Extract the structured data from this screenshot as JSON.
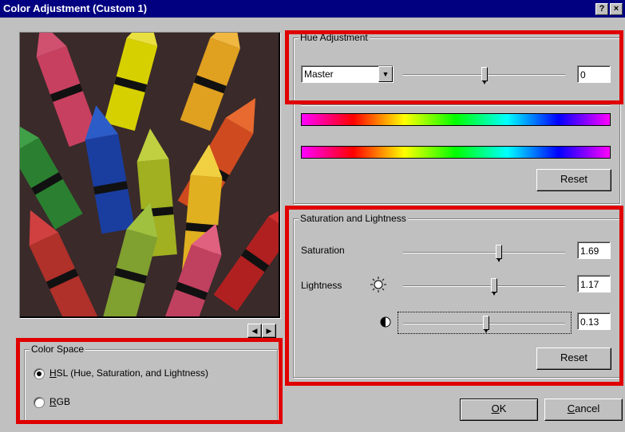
{
  "window": {
    "title": "Color Adjustment (Custom 1)",
    "help_icon": "?",
    "close_icon": "×"
  },
  "hue": {
    "legend": "Hue Adjustment",
    "channel_selected": "Master",
    "slider_fraction": 0.5,
    "value": "0",
    "reset_label": "Reset"
  },
  "sat_light": {
    "legend": "Saturation and Lightness",
    "saturation_label": "Saturation",
    "saturation_value": "1.69",
    "lightness_label": "Lightness",
    "lightness_value": "1.17",
    "contrast_value": "0.13",
    "reset_label": "Reset"
  },
  "color_space": {
    "legend": "Color Space",
    "hsl_hotkey": "H",
    "hsl_rest": "SL (Hue, Saturation, and Lightness)",
    "rgb_hotkey": "R",
    "rgb_rest": "GB",
    "selected": "HSL"
  },
  "footer": {
    "ok_hotkey": "O",
    "ok_rest": "K",
    "cancel_hotkey": "C",
    "cancel_rest": "ancel"
  },
  "colors": {
    "title_bar": "#000080",
    "highlight": "#e00000",
    "dialog": "#c0c0c0"
  }
}
